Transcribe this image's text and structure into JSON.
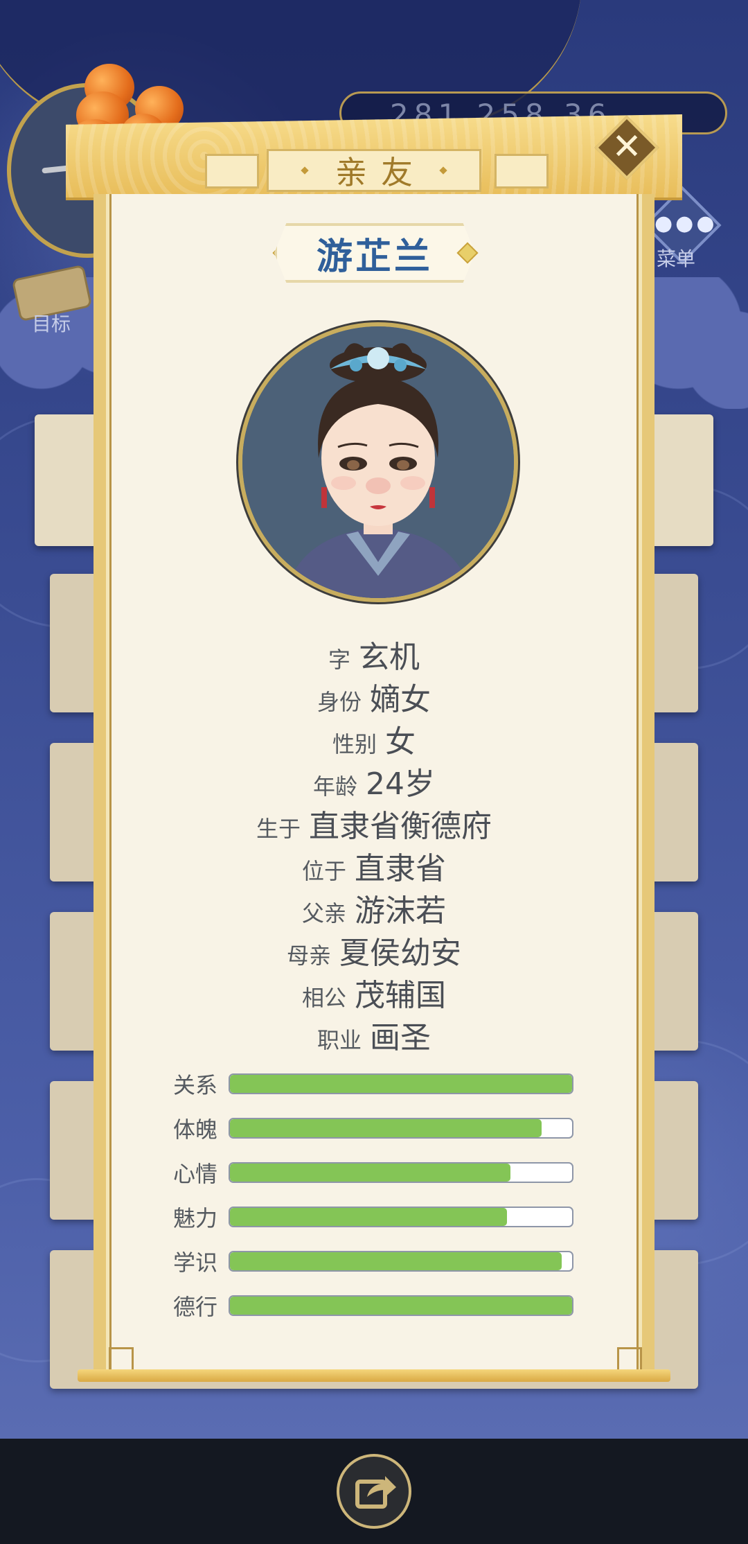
{
  "background": {
    "currency_text": "281 258 36",
    "menu_label": "菜单",
    "goal_label": "目标"
  },
  "dialog": {
    "title": "亲友",
    "close_icon": "close-icon",
    "name": "游芷兰",
    "info": [
      {
        "label": "字",
        "value": "玄机"
      },
      {
        "label": "身份",
        "value": "嫡女"
      },
      {
        "label": "性别",
        "value": "女"
      },
      {
        "label": "年龄",
        "value": "24岁"
      },
      {
        "label": "生于",
        "value": "直隶省衡德府"
      },
      {
        "label": "位于",
        "value": "直隶省"
      },
      {
        "label": "父亲",
        "value": "游沫若"
      },
      {
        "label": "母亲",
        "value": "夏侯幼安"
      },
      {
        "label": "相公",
        "value": "茂辅国"
      },
      {
        "label": "职业",
        "value": "画圣"
      }
    ],
    "stats": [
      {
        "label": "关系",
        "value": 1.0
      },
      {
        "label": "体魄",
        "value": 0.91
      },
      {
        "label": "心情",
        "value": 0.82
      },
      {
        "label": "魅力",
        "value": 0.81
      },
      {
        "label": "学识",
        "value": 0.97
      },
      {
        "label": "德行",
        "value": 1.0
      }
    ],
    "bar_color": "#84c556"
  },
  "footer": {
    "share_icon": "share-icon"
  }
}
